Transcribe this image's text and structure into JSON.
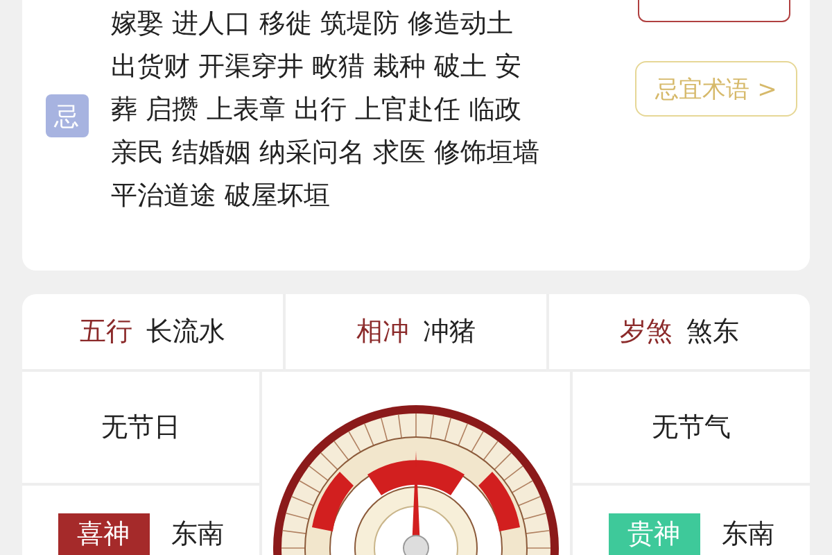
{
  "avoid_panel": {
    "badge": "忌",
    "lines": [
      "嫁娶 进人口 移徙 筑堤防 修造动土",
      "出货财 开渠穿井 畋猎 栽种 破土 安",
      "葬 启攒 上表章 出行 上官赴任 临政",
      "亲民 结婚姻 纳采问名 求医 修饰垣墙",
      "平治道途 破屋坏垣"
    ],
    "terms_button": "忌宜术语 >"
  },
  "info_row": [
    {
      "label": "五行",
      "value": "长流水"
    },
    {
      "label": "相冲",
      "value": "冲猪"
    },
    {
      "label": "岁煞",
      "value": "煞东"
    }
  ],
  "festival": "无节日",
  "solar_term": "无节气",
  "gods": [
    {
      "label": "喜神",
      "value": "东南",
      "color": "#a52a2a"
    },
    {
      "label": "贵神",
      "value": "东南",
      "color": "#3ec99a"
    }
  ]
}
